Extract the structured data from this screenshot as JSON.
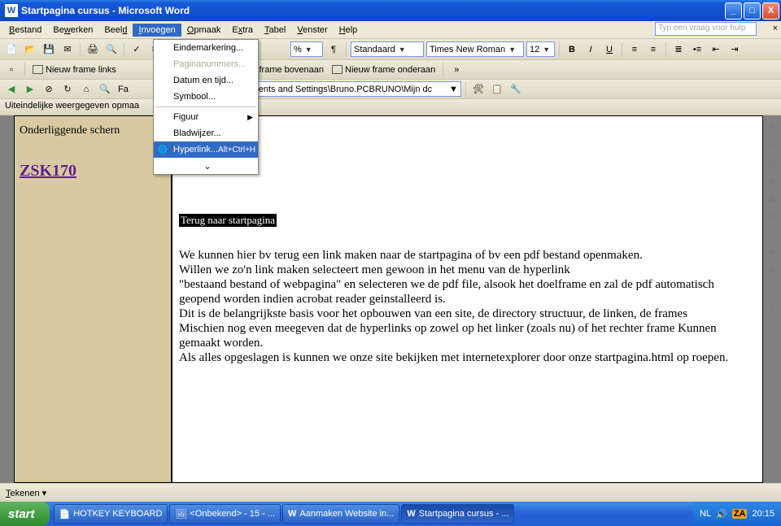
{
  "window": {
    "title": "Startpagina cursus - Microsoft Word",
    "app_icon": "W"
  },
  "winbtns": {
    "min": "_",
    "max": "□",
    "close": "X"
  },
  "menubar": {
    "items": [
      "Bestand",
      "Bewerken",
      "Beeld",
      "Invoegen",
      "Opmaak",
      "Extra",
      "Tabel",
      "Venster",
      "Help"
    ],
    "open_index": 3,
    "help_placeholder": "Typ een vraag voor hulp"
  },
  "dropdown": {
    "items": [
      {
        "label": "Eindemarkering...",
        "dim": false,
        "sub": false
      },
      {
        "label": "Paginanummers...",
        "dim": true,
        "sub": false
      },
      {
        "label": "Datum en tijd...",
        "dim": false,
        "sub": false
      },
      {
        "label": "Symbool...",
        "dim": false,
        "sub": false
      },
      {
        "sep": true
      },
      {
        "label": "Figuur",
        "dim": false,
        "sub": true
      },
      {
        "label": "Bladwijzer...",
        "dim": false,
        "sub": false
      },
      {
        "label": "Hyperlink...",
        "dim": false,
        "shortcut": "Alt+Ctrl+H",
        "hl": true,
        "icon": "🌐"
      }
    ],
    "expand": "⌄"
  },
  "tb1": {
    "zoom_like": "%",
    "style": "Standaard",
    "font": "Times New Roman",
    "size": "12",
    "bold": "B",
    "italic": "I",
    "underline": "U"
  },
  "tb2": {
    "frame_left": "Nieuw frame links",
    "frame_top": "ieuw frame bovenaan",
    "frame_bottom": "Nieuw frame onderaan"
  },
  "tb3": {
    "fav": "Fa",
    "path": "ocuments and Settings\\Bruno.PCBRUNO\\Mijn dc"
  },
  "infobar": "Uiteindelijke weergegeven opmaa",
  "doc": {
    "left_heading": "Onderliggende schern",
    "zsk": "ZSK170",
    "blackbar": "Terug naar startpagina",
    "body": "We kunnen hier bv terug een link maken naar de startpagina of bv een pdf bestand openmaken.\nWillen we zo'n link maken selecteert men gewoon in het menu van de hyperlink\n\"bestaand bestand of webpagina\" en selecteren we de pdf file, alsook het doelframe en zal de pdf automatisch geopend worden indien acrobat reader geinstalleerd is.\nDit is de belangrijkste basis voor het opbouwen van een site, de directory structuur, de linken, de frames\nMischien nog even meegeven dat de hyperlinks op zowel op het linker (zoals nu) of het rechter frame Kunnen gemaakt worden.\nAls alles opgeslagen is kunnen we onze site bekijken met internetexplorer door onze startpagina.html op roepen."
  },
  "drawbar": {
    "tekenen": "Tekenen"
  },
  "taskbar": {
    "start": "start",
    "items": [
      {
        "label": "HOTKEY KEYBOARD",
        "active": false
      },
      {
        "label": "<Onbekend> - 15 - ...",
        "active": false
      },
      {
        "label": "Aanmaken Website in...",
        "active": false
      },
      {
        "label": "Startpagina cursus - ...",
        "active": true
      }
    ],
    "lang": "NL",
    "clock": "20:15"
  }
}
